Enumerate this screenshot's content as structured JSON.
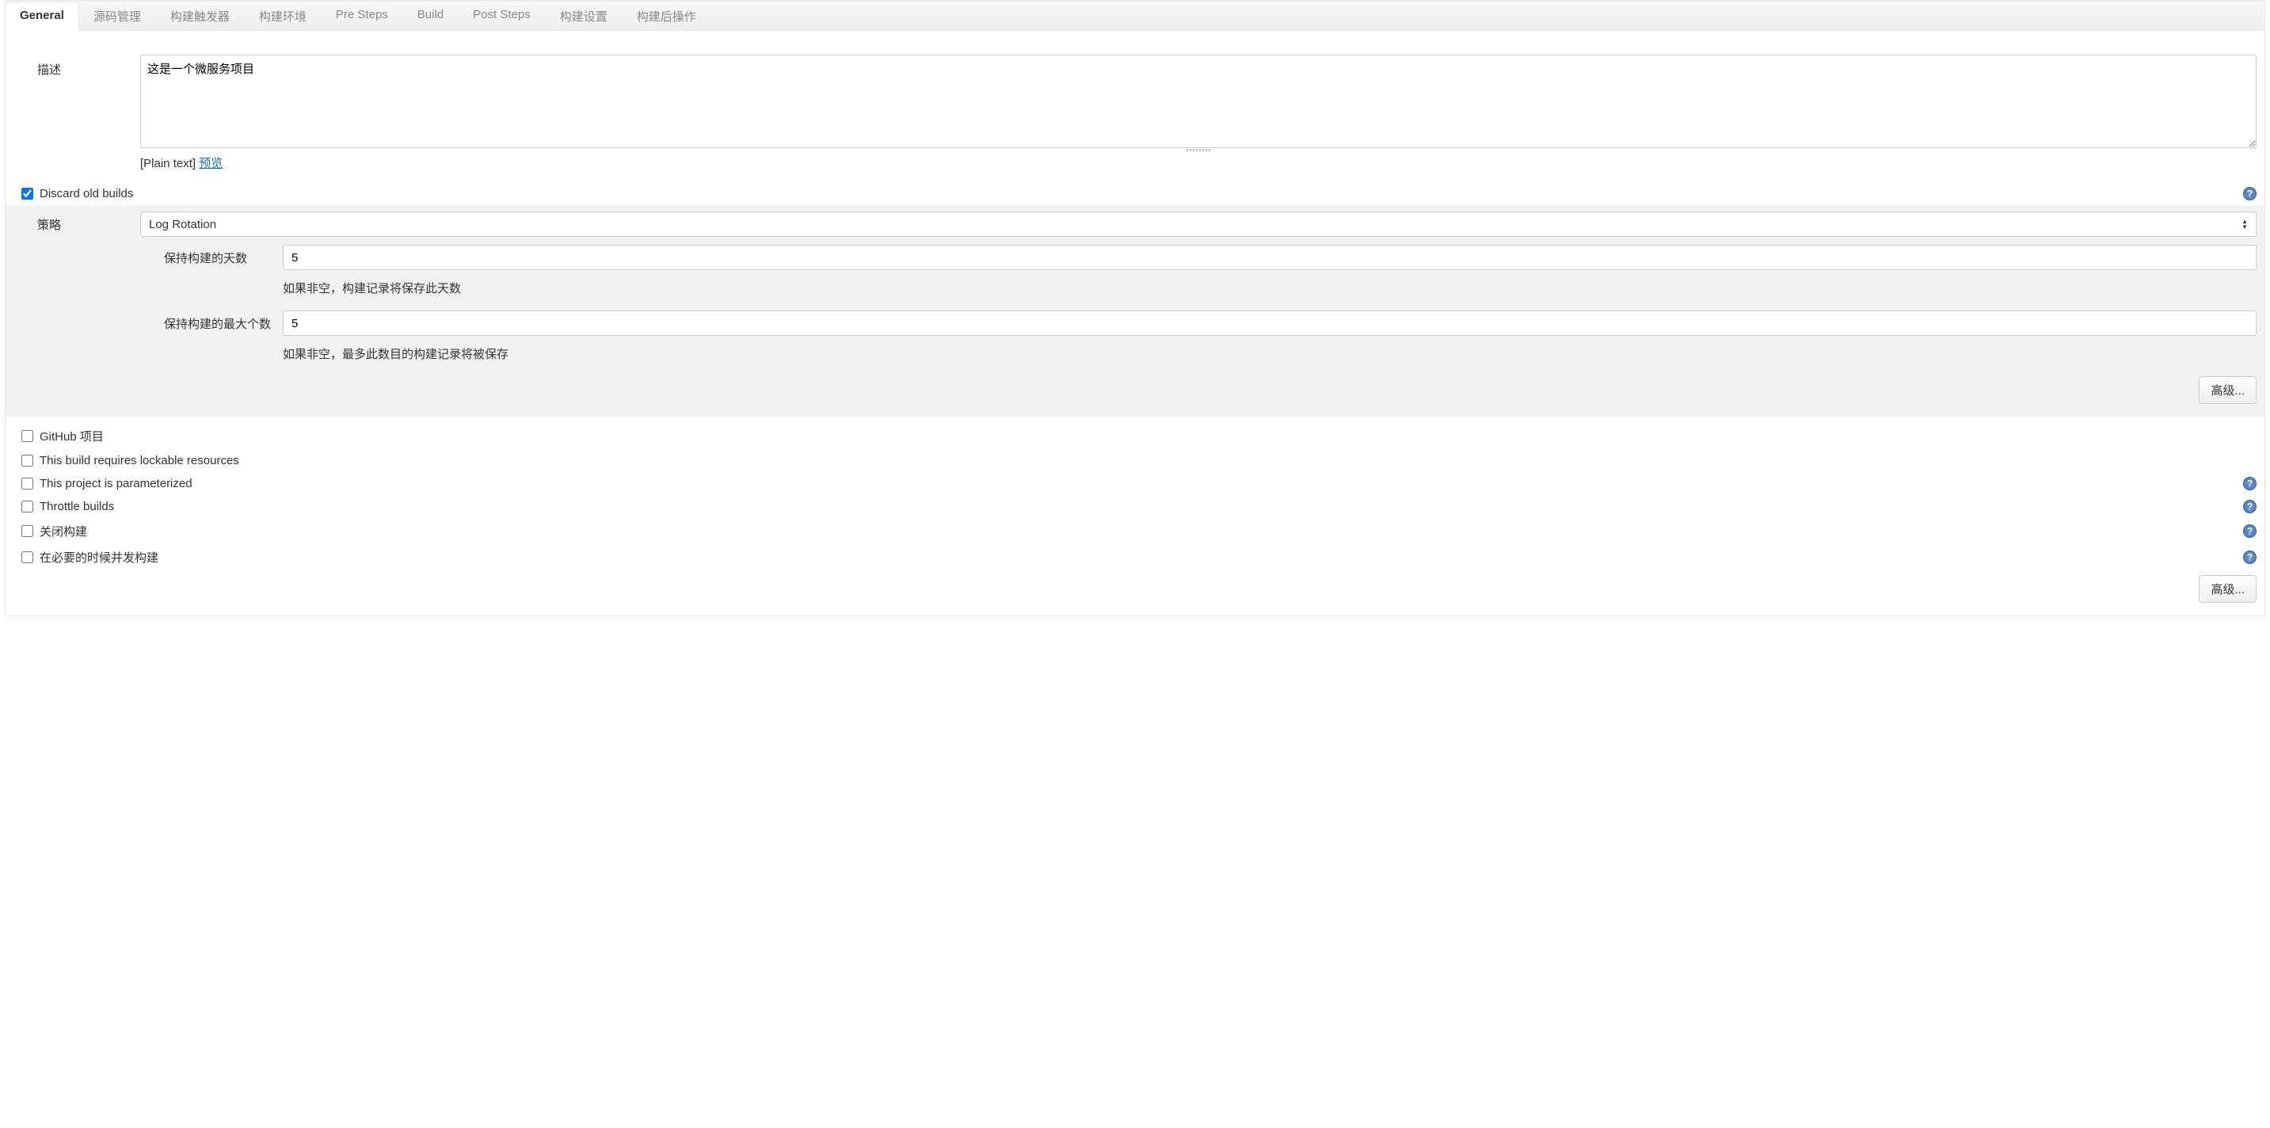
{
  "tabs": [
    {
      "label": "General",
      "active": true
    },
    {
      "label": "源码管理",
      "active": false
    },
    {
      "label": "构建触发器",
      "active": false
    },
    {
      "label": "构建环境",
      "active": false
    },
    {
      "label": "Pre Steps",
      "active": false
    },
    {
      "label": "Build",
      "active": false
    },
    {
      "label": "Post Steps",
      "active": false
    },
    {
      "label": "构建设置",
      "active": false
    },
    {
      "label": "构建后操作",
      "active": false
    }
  ],
  "description": {
    "label": "描述",
    "value": "这是一个微服务项目",
    "format_label": "[Plain text]",
    "preview_link": "预览"
  },
  "discard": {
    "label": "Discard old builds",
    "checked": true,
    "strategy_label": "策略",
    "strategy_value": "Log Rotation",
    "days": {
      "label": "保持构建的天数",
      "value": "5",
      "hint": "如果非空，构建记录将保存此天数"
    },
    "max": {
      "label": "保持构建的最大个数",
      "value": "5",
      "hint": "如果非空，最多此数目的构建记录将被保存"
    },
    "advanced_label": "高级..."
  },
  "options": [
    {
      "label": "GitHub 项目",
      "help": false
    },
    {
      "label": "This build requires lockable resources",
      "help": false
    },
    {
      "label": "This project is parameterized",
      "help": true
    },
    {
      "label": "Throttle builds",
      "help": true
    },
    {
      "label": "关闭构建",
      "help": true
    },
    {
      "label": "在必要的时候并发构建",
      "help": true
    }
  ],
  "bottom_advanced_label": "高级..."
}
